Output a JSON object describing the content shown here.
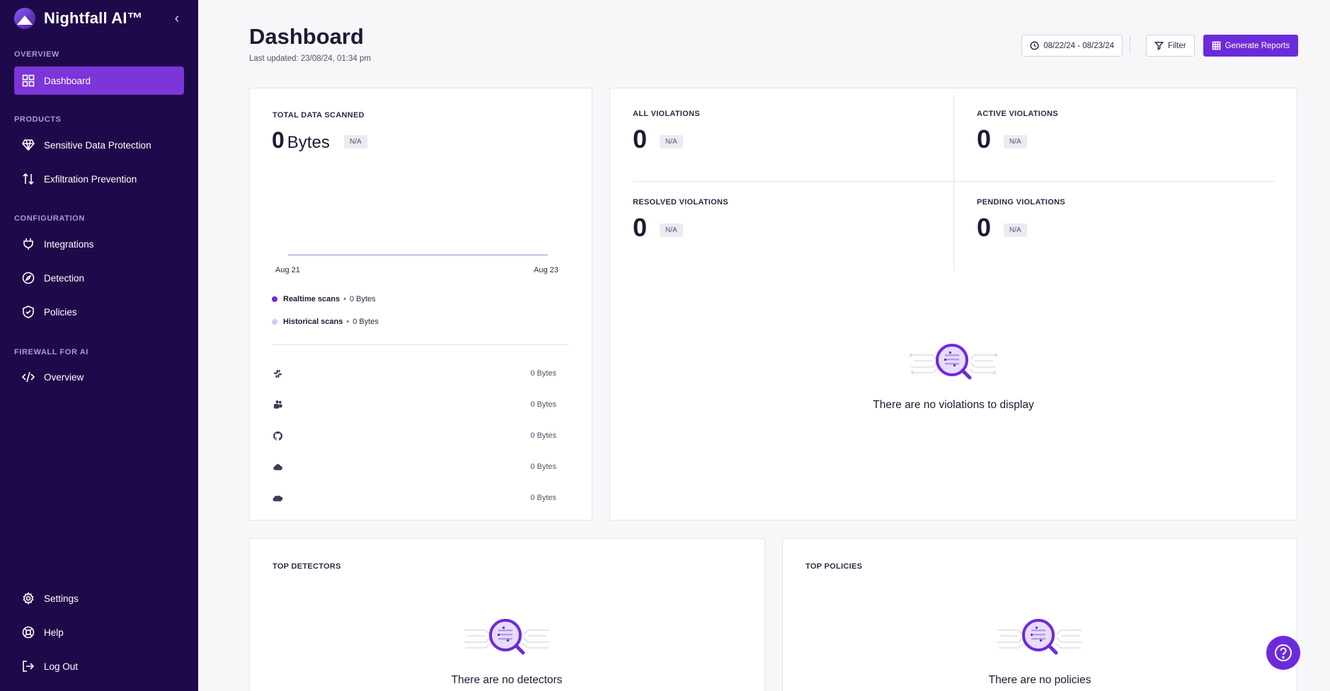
{
  "brand": {
    "name": "Nightfall AI™"
  },
  "sidebar": {
    "sections": {
      "overview": "OVERVIEW",
      "products": "PRODUCTS",
      "configuration": "CONFIGURATION",
      "firewall": "FIREWALL FOR AI"
    },
    "items": {
      "dashboard": "Dashboard",
      "sensitive": "Sensitive Data Protection",
      "exfiltration": "Exfiltration Prevention",
      "integrations": "Integrations",
      "detection": "Detection",
      "policies": "Policies",
      "overview": "Overview",
      "settings": "Settings",
      "help": "Help",
      "logout": "Log Out"
    }
  },
  "header": {
    "title": "Dashboard",
    "last_updated": "Last updated: 23/08/24, 01:34 pm",
    "date_range": "08/22/24 - 08/23/24",
    "filter_label": "Filter",
    "generate_label": "Generate Reports"
  },
  "scanned": {
    "label": "TOTAL DATA SCANNED",
    "value": "0",
    "unit": "Bytes",
    "badge": "N/A",
    "x_start": "Aug 21",
    "x_end": "Aug 23",
    "legend": [
      {
        "name": "Realtime scans",
        "value": "0 Bytes",
        "color": "#6c2bd9"
      },
      {
        "name": "Historical scans",
        "value": "0 Bytes",
        "color": "#d8c8f3"
      }
    ],
    "sources": [
      {
        "icon": "slack-icon",
        "value": "0 Bytes"
      },
      {
        "icon": "teams-icon",
        "value": "0 Bytes"
      },
      {
        "icon": "github-icon",
        "value": "0 Bytes"
      },
      {
        "icon": "cloud-icon",
        "value": "0 Bytes"
      },
      {
        "icon": "salesforce-icon",
        "value": "0 Bytes"
      }
    ]
  },
  "violations": {
    "all": {
      "label": "ALL VIOLATIONS",
      "value": "0",
      "badge": "N/A"
    },
    "active": {
      "label": "ACTIVE VIOLATIONS",
      "value": "0",
      "badge": "N/A"
    },
    "resolved": {
      "label": "RESOLVED VIOLATIONS",
      "value": "0",
      "badge": "N/A"
    },
    "pending": {
      "label": "PENDING VIOLATIONS",
      "value": "0",
      "badge": "N/A"
    },
    "empty_text": "There are no violations to display"
  },
  "detectors": {
    "label": "TOP DETECTORS",
    "empty_text": "There are no detectors"
  },
  "policies": {
    "label": "TOP POLICIES",
    "empty_text": "There are no policies"
  },
  "colors": {
    "sidebar_bg": "#1e0a4a",
    "accent": "#6c2bd9",
    "active_nav": "#7b35d8"
  }
}
